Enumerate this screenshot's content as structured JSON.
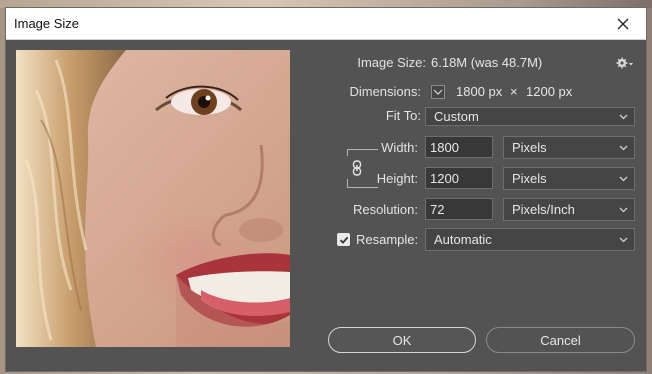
{
  "window": {
    "title": "Image Size"
  },
  "image_size": {
    "label": "Image Size:",
    "value": "6.18M (was 48.7M)"
  },
  "dimensions": {
    "label": "Dimensions:",
    "width": "1800 px",
    "times": "×",
    "height": "1200 px"
  },
  "fit_to": {
    "label": "Fit To:",
    "value": "Custom"
  },
  "width": {
    "label": "Width:",
    "value": "1800",
    "unit": "Pixels"
  },
  "height": {
    "label": "Height:",
    "value": "1200",
    "unit": "Pixels"
  },
  "resolution": {
    "label": "Resolution:",
    "value": "72",
    "unit": "Pixels/Inch"
  },
  "resample": {
    "label": "Resample:",
    "checked": true,
    "value": "Automatic"
  },
  "buttons": {
    "ok": "OK",
    "cancel": "Cancel"
  },
  "icons": [
    "close-icon",
    "gear-icon",
    "chevron-down-icon",
    "chain-link-icon",
    "checkmark-icon"
  ],
  "colors": {
    "dialog_bg": "#535353",
    "field_bg": "#454545",
    "text": "#e6e6e6"
  }
}
